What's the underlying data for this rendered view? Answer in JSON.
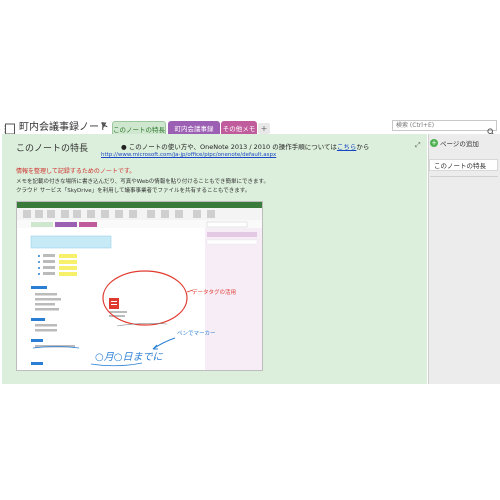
{
  "notebook": {
    "title": "町内会議事録ノート"
  },
  "tabs": [
    {
      "label": "このノートの特長",
      "active": true,
      "color": "#cfe6cf"
    },
    {
      "label": "町内会議事録",
      "active": false,
      "color": "#9b5fb3"
    },
    {
      "label": "その他メモ",
      "active": false,
      "color": "#c05c9c"
    }
  ],
  "search": {
    "placeholder": "検索 (Ctrl+E)"
  },
  "page": {
    "title": "このノートの特長",
    "bullet_pre": "このノートの使い方や、OneNote 2013 / 2010 の操作手順については",
    "bullet_link": "こちら",
    "bullet_post": "から",
    "url": "http://www.microsoft.com/ja-jp/office/pipc/onenote/default.aspx",
    "heading": "情報を整理して記録するためのノートです。",
    "lines": [
      "メモを記載の付きな場所に書き込んだり、写真やWebの情報を貼り付けることもでき簡単にできます。",
      "クラウド サービス「SkyDrive」を利用して議事事業者でファイルを共有することもできます。"
    ]
  },
  "sidebar": {
    "add_page": "ページの追加",
    "pages": [
      "このノートの特長"
    ]
  },
  "screenshot": {
    "inner_title": "「第○回 役員会」○月○日 (曜日)",
    "inner_tabs": [
      "このノートの特長",
      "町内会議事録",
      "その他メモ"
    ],
    "annotation_tag": "データタグの活用",
    "annotation_pen": "ペンでマーカー",
    "handwriting": "○月○日までに",
    "info_labels": [
      "日時",
      "場所",
      "出席者",
      "欠席者"
    ],
    "info_values": [
      "○月○日",
      "○○公民館",
      "○○○○",
      "○○○○"
    ],
    "section_labels": [
      "議事",
      "決定事項",
      "宿題"
    ],
    "list_items": [
      "○○祭りの準備について",
      "○○○○の件",
      "○○○○について",
      "○○○○の確認"
    ],
    "doc_caption": "○○○○\n○○○○"
  },
  "colors": {
    "page_bg": "#dcefdc",
    "accent_green": "#4caf50",
    "link_blue": "#1a47c4",
    "annotation_red": "#e03a2f",
    "annotation_blue": "#2a7fd4"
  }
}
